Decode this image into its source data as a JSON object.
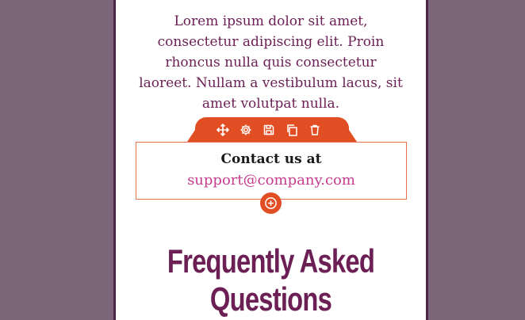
{
  "content": {
    "lorem_text": "Lorem ipsum dolor sit amet, consectetur adipiscing elit. Proin rhoncus nulla quis consectetur laoreet. Nullam a vestibulum lacus, sit amet volutpat nulla."
  },
  "toolbar": {
    "icons": [
      "move-icon",
      "gear-icon",
      "save-icon",
      "duplicate-icon",
      "trash-icon"
    ]
  },
  "contact_block": {
    "label": "Contact us at",
    "email": "support@company.com"
  },
  "faq": {
    "heading": "Frequently Asked Questions"
  },
  "colors": {
    "background": "#7b6679",
    "accent": "#e24e23",
    "text_primary": "#6b1f54",
    "link": "#c73d8e"
  }
}
